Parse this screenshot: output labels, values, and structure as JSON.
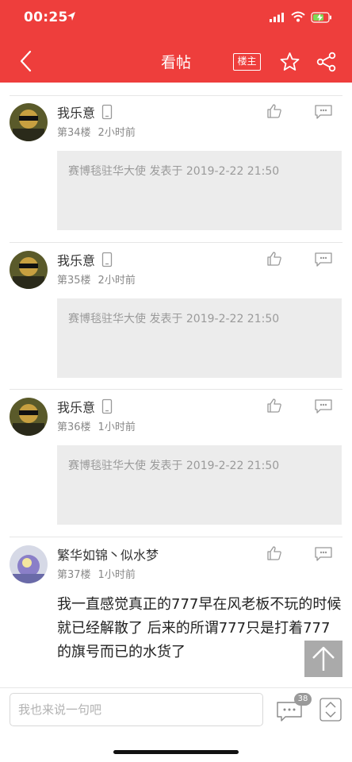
{
  "status_bar": {
    "time": "00:25"
  },
  "nav": {
    "title": "看帖",
    "op_badge": "楼主"
  },
  "colors": {
    "brand_red": "#ee3e3c",
    "quote_bg": "#ececec",
    "meta_gray": "#888888"
  },
  "icons": {
    "back": "chevron-left-icon",
    "star": "star-icon",
    "share": "share-icon",
    "like": "thumbs-up-icon",
    "reply": "reply-bubble-icon",
    "device": "phone-icon",
    "scroll_top": "arrow-up-icon",
    "comments": "comment-bubble-icon",
    "pager": "up-down-chevron-icon"
  },
  "posts": [
    {
      "username": "我乐意",
      "floor": "第34楼",
      "time": "2小时前",
      "quote": "赛博毯驻华大使 发表于 2019-2-22 21:50"
    },
    {
      "username": "我乐意",
      "floor": "第35楼",
      "time": "2小时前",
      "quote": "赛博毯驻华大使 发表于 2019-2-22 21:50"
    },
    {
      "username": "我乐意",
      "floor": "第36楼",
      "time": "1小时前",
      "quote": "赛博毯驻华大使 发表于 2019-2-22 21:50"
    },
    {
      "username": "繁华如锦丶似水梦",
      "floor": "第37楼",
      "time": "1小时前",
      "text": "我一直感觉真正的777早在风老板不玩的时候就已经解散了   后来的所谓777只是打着777的旗号而已的水货了"
    }
  ],
  "bottom": {
    "input_placeholder": "我也来说一句吧",
    "comment_count": "38"
  }
}
